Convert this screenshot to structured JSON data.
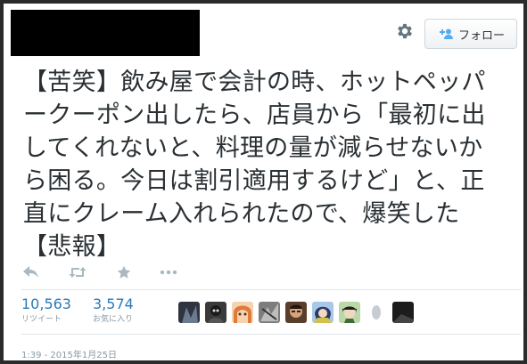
{
  "header": {
    "follow_label": "フォロー",
    "settings_icon": "gear-icon",
    "follow_icon": "add-user-icon"
  },
  "tweet": {
    "lines": [
      "【苦笑】飲み屋で会計の時、ホットペッパ",
      "ークーポン出したら、店員から「最初に出",
      "してくれないと、料理の量が減らせないか",
      "ら困る。今日は割引適用するけど」と、正",
      "直にクレーム入れられたので、爆笑した",
      "【悲報】"
    ]
  },
  "actions": {
    "reply_icon": "reply-icon",
    "retweet_icon": "retweet-icon",
    "favorite_icon": "star-icon",
    "more_icon": "more-icon"
  },
  "stats": {
    "retweets": {
      "count": "10,563",
      "label": "リツイート"
    },
    "favorites": {
      "count": "3,574",
      "label": "お気に入り"
    }
  },
  "avatars": [
    {
      "name": "avatar-1",
      "color": "#2e3440"
    },
    {
      "name": "avatar-2",
      "color": "#3a3a3a"
    },
    {
      "name": "avatar-3",
      "color": "#e8a67a"
    },
    {
      "name": "avatar-4",
      "color": "#7d7d7d"
    },
    {
      "name": "avatar-5",
      "color": "#5a3e2b"
    },
    {
      "name": "avatar-6",
      "color": "#4a6fa5"
    },
    {
      "name": "avatar-7",
      "color": "#3f6b3a"
    },
    {
      "name": "avatar-8",
      "color": "#d9d9d9"
    },
    {
      "name": "avatar-9",
      "color": "#1c1c1c"
    }
  ],
  "timestamp": "1:39 - 2015年1月25日",
  "colors": {
    "link_blue": "#2b7bb9",
    "text": "#292f33",
    "muted": "#8899a6",
    "border": "#2b2b2b"
  }
}
